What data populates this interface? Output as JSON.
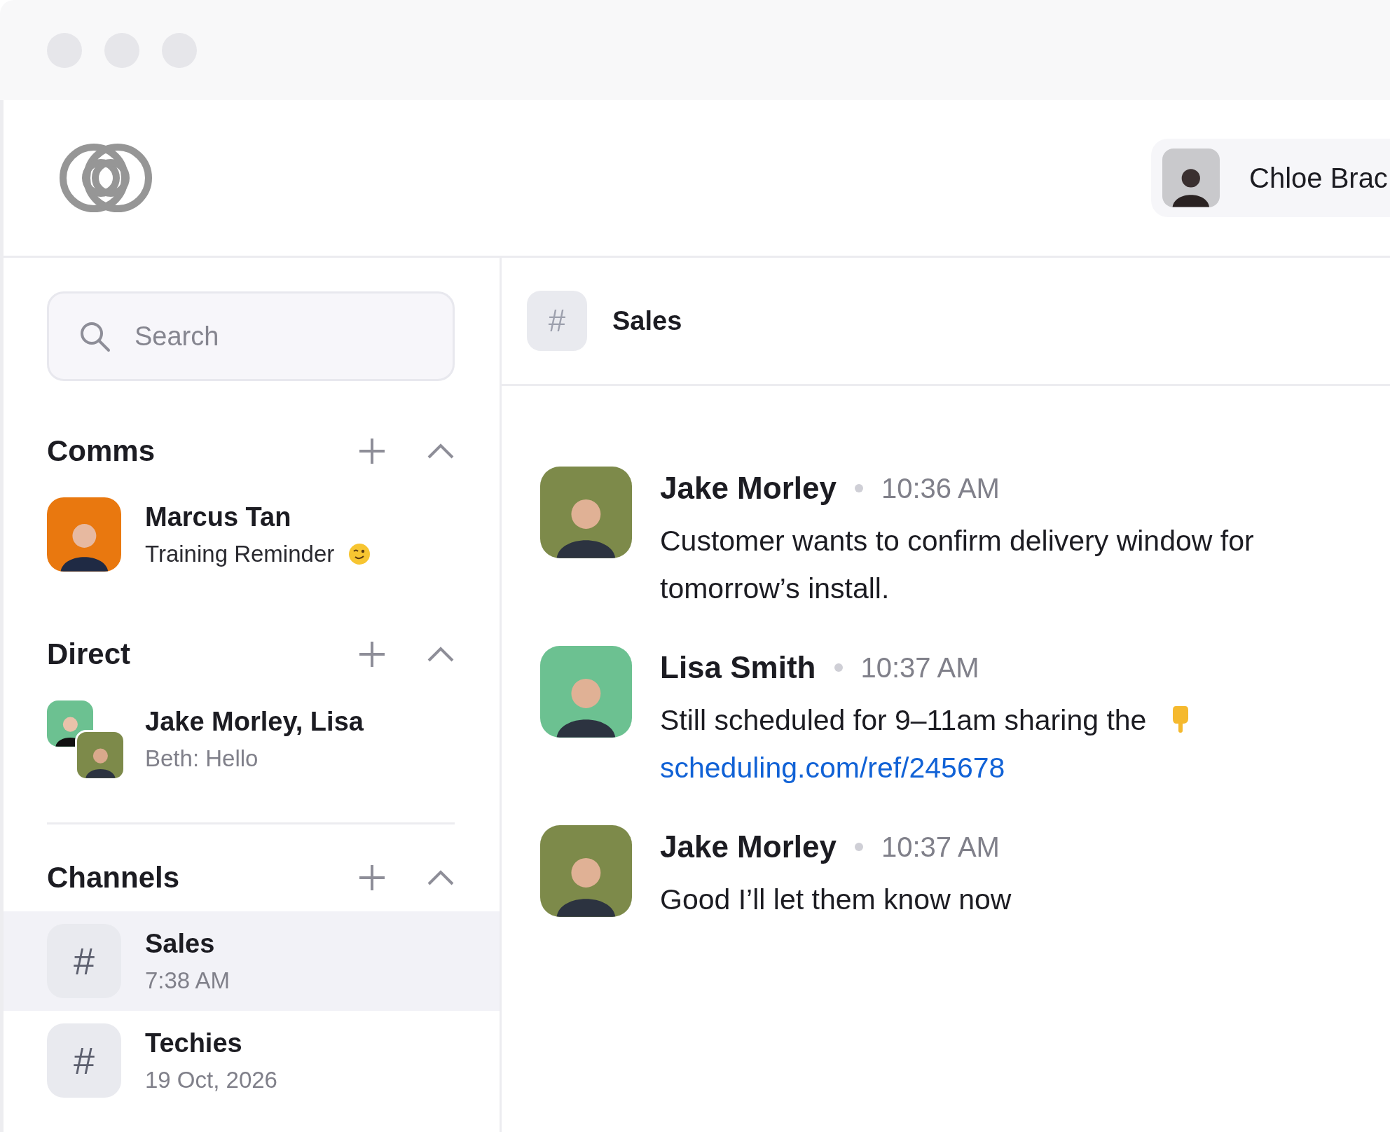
{
  "user": {
    "name": "Chloe Brac"
  },
  "search": {
    "placeholder": "Search"
  },
  "sections": [
    {
      "title": "Comms",
      "expanded": true,
      "items": [
        {
          "kind": "person",
          "name": "Marcus Tan",
          "subtitle": "Training Reminder",
          "emoji": true,
          "selected": false
        }
      ]
    },
    {
      "title": "Direct",
      "expanded": true,
      "items": [
        {
          "kind": "group",
          "name": "Jake Morley, Lisa",
          "subtitle": "Beth: Hello",
          "selected": false
        }
      ]
    },
    {
      "title": "Channels",
      "expanded": true,
      "items": [
        {
          "kind": "channel",
          "icon": "#",
          "name": "Sales",
          "subtitle": "7:38 AM",
          "selected": true
        },
        {
          "kind": "channel",
          "icon": "#",
          "name": "Techies",
          "subtitle": "19 Oct, 2026",
          "selected": false
        }
      ]
    }
  ],
  "channel": {
    "icon": "#",
    "name": "Sales"
  },
  "messages": [
    {
      "author": "Jake Morley",
      "time": "10:36 AM",
      "text": "Customer wants to confirm delivery window for tomorrow’s install."
    },
    {
      "author": "Lisa Smith",
      "time": "10:37 AM",
      "text": "Still scheduled for 9–11am sharing the",
      "emoji": true,
      "link": "scheduling.com/ref/245678"
    },
    {
      "author": "Jake Morley",
      "time": "10:37 AM",
      "text": "Good I’ll let them know now"
    }
  ]
}
